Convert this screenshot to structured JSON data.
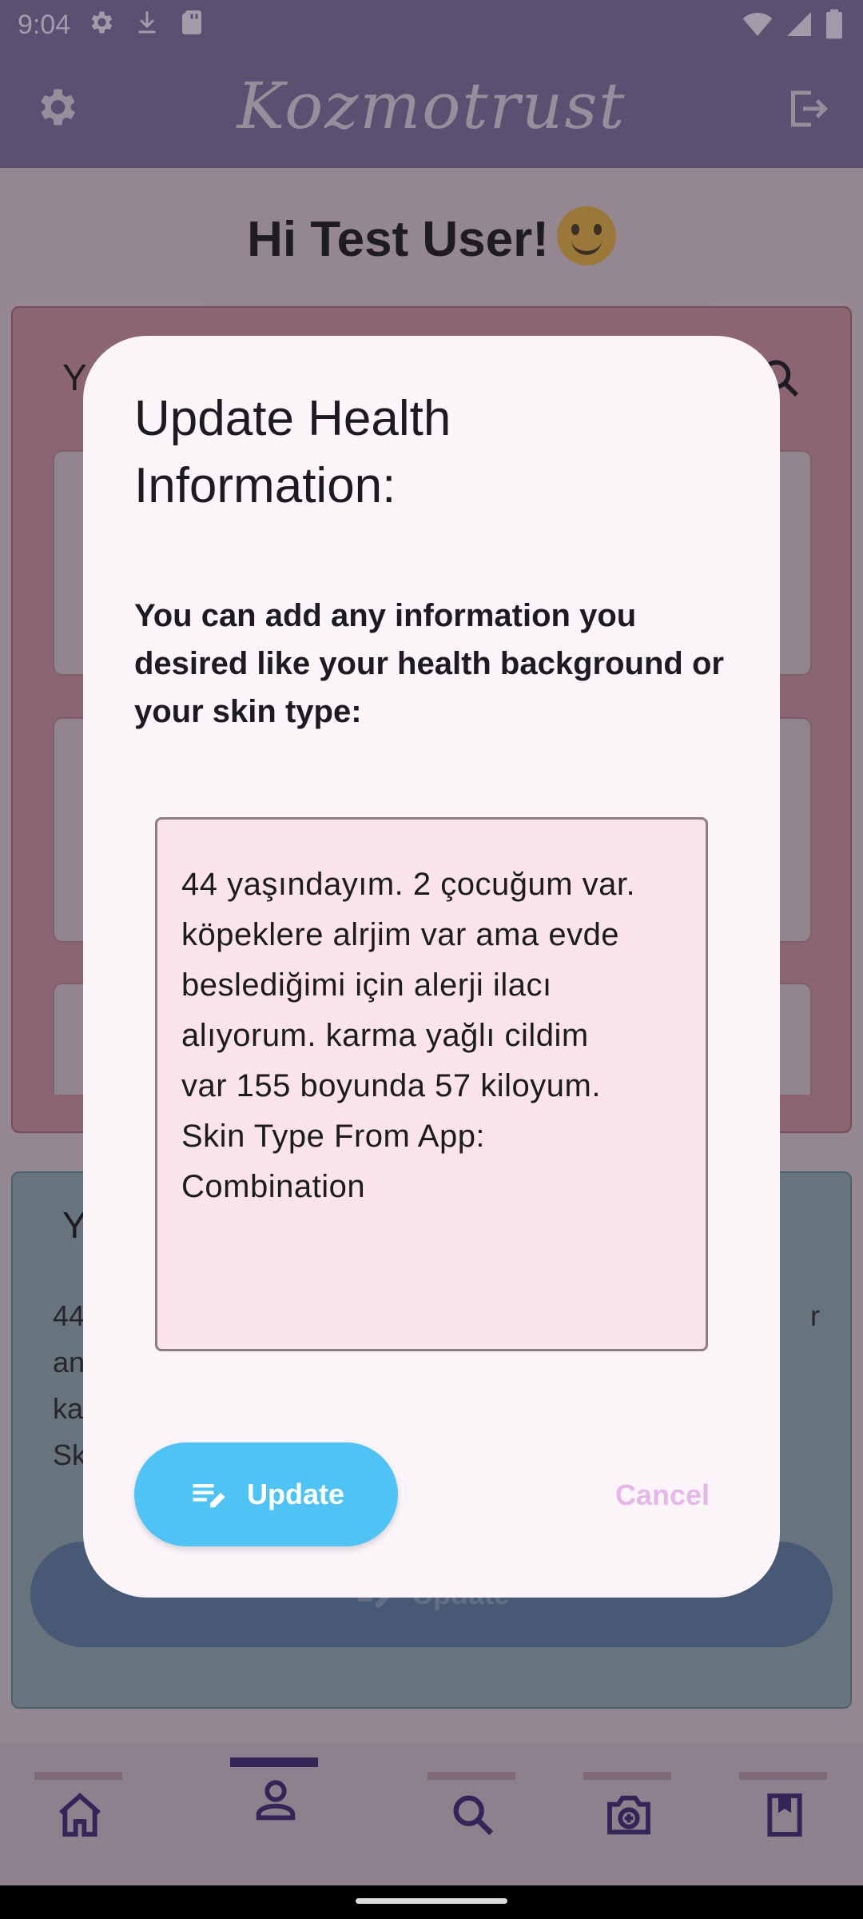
{
  "status_bar": {
    "time": "9:04",
    "left_icons": [
      "gear-icon",
      "download-icon",
      "sd-card-icon"
    ],
    "right_icons": [
      "wifi-icon",
      "signal-icon",
      "battery-icon"
    ]
  },
  "app_bar": {
    "logo": "Kozmotrust",
    "left_icon": "gear-icon",
    "right_icon": "logout-icon"
  },
  "greeting": "Hi Test User!",
  "underlay": {
    "section_one_title": "Y",
    "section_two_title": "Y",
    "section_two_body": "44 yaşındayım. 2 çocuğum var. köpeklere alrjim var ama evde besl… ar\nan\nka\nSk",
    "section_two_lines": [
      "44",
      "an",
      "ka",
      "Sk"
    ],
    "section_two_tail": "r",
    "update_label": "Update"
  },
  "dialog": {
    "title": "Update Health Information:",
    "description": "You can add any information you desired like your health background or your skin type:",
    "field_value": "44 yaşındayım. 2 çocuğum var.\nköpeklere alrjim var ama evde\nbeslediğimi için alerji ilacı\nalıyorum. karma yağlı cildim\nvar 155 boyunda 57 kiloyum.\nSkin Type From App:\nCombination",
    "update_label": "Update",
    "cancel_label": "Cancel"
  },
  "bottom_nav": {
    "items": [
      {
        "icon": "home-icon",
        "active": false
      },
      {
        "icon": "person-icon",
        "active": true
      },
      {
        "icon": "search-icon",
        "active": false
      },
      {
        "icon": "camera-scan-icon",
        "active": false
      },
      {
        "icon": "bookmark-book-icon",
        "active": false
      }
    ]
  },
  "colors": {
    "accent_update": "#50c3f5",
    "cancel_text": "#e3b8e6",
    "nav_active": "#3d2b72",
    "dialog_bg": "#fbf5fa",
    "field_bg": "#fae4ea"
  }
}
